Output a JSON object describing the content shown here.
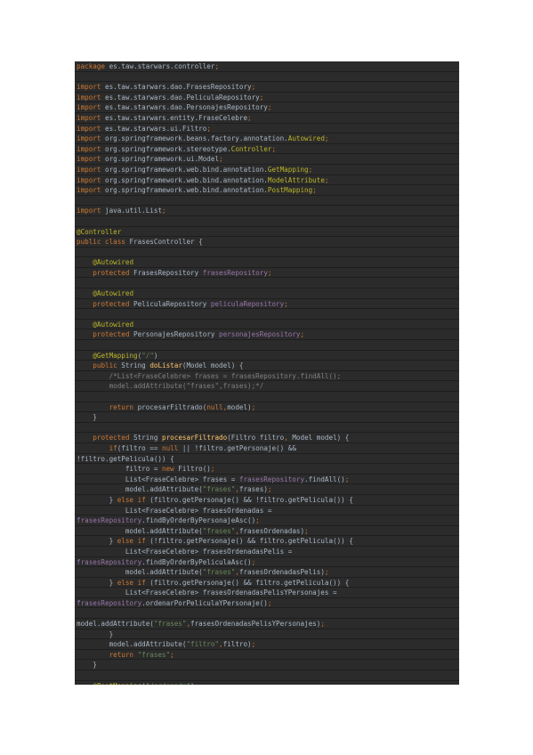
{
  "colors": {
    "background": "#2b2b2b",
    "text": "#a9b7c6",
    "keyword": "#cc7832",
    "annotation": "#bbb529",
    "field": "#9876aa",
    "method": "#ffc66d",
    "string": "#6a8759",
    "comment": "#808080"
  },
  "code_lines": [
    [
      [
        "kw",
        "package"
      ],
      [
        "txt",
        " es.taw.starwars.controller"
      ],
      [
        "kw",
        ";"
      ]
    ],
    [],
    [
      [
        "kw",
        "import"
      ],
      [
        "txt",
        " es.taw.starwars.dao.FrasesRepository"
      ],
      [
        "kw",
        ";"
      ]
    ],
    [
      [
        "kw",
        "import"
      ],
      [
        "txt",
        " es.taw.starwars.dao.PeliculaRepository"
      ],
      [
        "kw",
        ";"
      ]
    ],
    [
      [
        "kw",
        "import"
      ],
      [
        "txt",
        " es.taw.starwars.dao.PersonajesRepository"
      ],
      [
        "kw",
        ";"
      ]
    ],
    [
      [
        "kw",
        "import"
      ],
      [
        "txt",
        " es.taw.starwars.entity.FraseCelebre"
      ],
      [
        "kw",
        ";"
      ]
    ],
    [
      [
        "kw",
        "import"
      ],
      [
        "txt",
        " es.taw.starwars.ui.Filtro"
      ],
      [
        "kw",
        ";"
      ]
    ],
    [
      [
        "kw",
        "import"
      ],
      [
        "txt",
        " org.springframework.beans.factory.annotation."
      ],
      [
        "ann",
        "Autowired"
      ],
      [
        "kw",
        ";"
      ]
    ],
    [
      [
        "kw",
        "import"
      ],
      [
        "txt",
        " org.springframework.stereotype."
      ],
      [
        "ann",
        "Controller"
      ],
      [
        "kw",
        ";"
      ]
    ],
    [
      [
        "kw",
        "import"
      ],
      [
        "txt",
        " org.springframework.ui.Model"
      ],
      [
        "kw",
        ";"
      ]
    ],
    [
      [
        "kw",
        "import"
      ],
      [
        "txt",
        " org.springframework.web.bind.annotation."
      ],
      [
        "ann",
        "GetMapping"
      ],
      [
        "kw",
        ";"
      ]
    ],
    [
      [
        "kw",
        "import"
      ],
      [
        "txt",
        " org.springframework.web.bind.annotation."
      ],
      [
        "ann",
        "ModelAttribute"
      ],
      [
        "kw",
        ";"
      ]
    ],
    [
      [
        "kw",
        "import"
      ],
      [
        "txt",
        " org.springframework.web.bind.annotation."
      ],
      [
        "ann",
        "PostMapping"
      ],
      [
        "kw",
        ";"
      ]
    ],
    [],
    [
      [
        "kw",
        "import"
      ],
      [
        "txt",
        " java.util.List"
      ],
      [
        "kw",
        ";"
      ]
    ],
    [],
    [
      [
        "ann",
        "@Controller"
      ]
    ],
    [
      [
        "kw",
        "public class"
      ],
      [
        "txt",
        " FrasesController {"
      ]
    ],
    [],
    [
      [
        "txt",
        "    "
      ],
      [
        "ann",
        "@Autowired"
      ]
    ],
    [
      [
        "txt",
        "    "
      ],
      [
        "kw",
        "protected"
      ],
      [
        "txt",
        " FrasesRepository "
      ],
      [
        "field",
        "frasesRepository"
      ],
      [
        "kw",
        ";"
      ]
    ],
    [],
    [
      [
        "txt",
        "    "
      ],
      [
        "ann",
        "@Autowired"
      ]
    ],
    [
      [
        "txt",
        "    "
      ],
      [
        "kw",
        "protected"
      ],
      [
        "txt",
        " PeliculaRepository "
      ],
      [
        "field",
        "peliculaRepository"
      ],
      [
        "kw",
        ";"
      ]
    ],
    [],
    [
      [
        "txt",
        "    "
      ],
      [
        "ann",
        "@Autowired"
      ]
    ],
    [
      [
        "txt",
        "    "
      ],
      [
        "kw",
        "protected"
      ],
      [
        "txt",
        " PersonajesRepository "
      ],
      [
        "field",
        "personajesRepository"
      ],
      [
        "kw",
        ";"
      ]
    ],
    [],
    [
      [
        "txt",
        "    "
      ],
      [
        "ann",
        "@GetMapping"
      ],
      [
        "txt",
        "("
      ],
      [
        "str",
        "\"/\""
      ],
      [
        "txt",
        ")"
      ]
    ],
    [
      [
        "txt",
        "    "
      ],
      [
        "kw",
        "public"
      ],
      [
        "txt",
        " String "
      ],
      [
        "fn",
        "doListar"
      ],
      [
        "txt",
        "(Model model) {"
      ]
    ],
    [
      [
        "txt",
        "        "
      ],
      [
        "cmt",
        "/*List<FraseCelebre> frases = frasesRepository.findAll();"
      ]
    ],
    [
      [
        "txt",
        "        "
      ],
      [
        "cmt",
        "model.addAttribute(\"frases\",frases);*/"
      ]
    ],
    [],
    [
      [
        "txt",
        "        "
      ],
      [
        "kw",
        "return"
      ],
      [
        "txt",
        " procesarFiltrado("
      ],
      [
        "kw",
        "null"
      ],
      [
        "kw",
        ","
      ],
      [
        "txt",
        "model)"
      ],
      [
        "kw",
        ";"
      ]
    ],
    [
      [
        "txt",
        "    }"
      ]
    ],
    [],
    [
      [
        "txt",
        "    "
      ],
      [
        "kw",
        "protected"
      ],
      [
        "txt",
        " String "
      ],
      [
        "fn",
        "procesarFiltrado"
      ],
      [
        "txt",
        "(Filtro filtro"
      ],
      [
        "kw",
        ","
      ],
      [
        "txt",
        " Model model) {"
      ]
    ],
    [
      [
        "txt",
        "        "
      ],
      [
        "kw",
        "if"
      ],
      [
        "txt",
        "(filtro == "
      ],
      [
        "kw",
        "null"
      ],
      [
        "txt",
        " || !filtro.getPersonaje() &&"
      ]
    ],
    [
      [
        "txt",
        "!filtro.getPelicula()) {"
      ]
    ],
    [
      [
        "txt",
        "            filtro = "
      ],
      [
        "kw",
        "new"
      ],
      [
        "txt",
        " Filtro()"
      ],
      [
        "kw",
        ";"
      ]
    ],
    [
      [
        "txt",
        "            List<FraseCelebre> frases = "
      ],
      [
        "field",
        "frasesRepository"
      ],
      [
        "txt",
        ".findAll()"
      ],
      [
        "kw",
        ";"
      ]
    ],
    [
      [
        "txt",
        "            model.addAttribute("
      ],
      [
        "str",
        "\"frases\""
      ],
      [
        "kw",
        ","
      ],
      [
        "txt",
        "frases)"
      ],
      [
        "kw",
        ";"
      ]
    ],
    [
      [
        "txt",
        "        } "
      ],
      [
        "kw",
        "else if"
      ],
      [
        "txt",
        " (filtro.getPersonaje() && !filtro.getPelicula()) {"
      ]
    ],
    [
      [
        "txt",
        "            List<FraseCelebre> frasesOrdenadas ="
      ]
    ],
    [
      [
        "field",
        "frasesRepository"
      ],
      [
        "txt",
        ".findByOrderByPersonajeAsc()"
      ],
      [
        "kw",
        ";"
      ]
    ],
    [
      [
        "txt",
        "            model.addAttribute("
      ],
      [
        "str",
        "\"frases\""
      ],
      [
        "kw",
        ","
      ],
      [
        "txt",
        "frasesOrdenadas)"
      ],
      [
        "kw",
        ";"
      ]
    ],
    [
      [
        "txt",
        "        } "
      ],
      [
        "kw",
        "else if"
      ],
      [
        "txt",
        " (!filtro.getPersonaje() && filtro.getPelicula()) {"
      ]
    ],
    [
      [
        "txt",
        "            List<FraseCelebre> frasesOrdenadasPelis ="
      ]
    ],
    [
      [
        "field",
        "frasesRepository"
      ],
      [
        "txt",
        ".findByOrderByPeliculaAsc()"
      ],
      [
        "kw",
        ";"
      ]
    ],
    [
      [
        "txt",
        "            model.addAttribute("
      ],
      [
        "str",
        "\"frases\""
      ],
      [
        "kw",
        ","
      ],
      [
        "txt",
        "frasesOrdenadasPelis)"
      ],
      [
        "kw",
        ";"
      ]
    ],
    [
      [
        "txt",
        "        } "
      ],
      [
        "kw",
        "else if"
      ],
      [
        "txt",
        " (filtro.getPersonaje() && filtro.getPelicula()) {"
      ]
    ],
    [
      [
        "txt",
        "            List<FraseCelebre> frasesOrdenadasPelisYPersonajes ="
      ]
    ],
    [
      [
        "field",
        "frasesRepository"
      ],
      [
        "txt",
        ".ordenarPorPeliculaYPersonaje()"
      ],
      [
        "kw",
        ";"
      ]
    ],
    [],
    [
      [
        "txt",
        "model.addAttribute("
      ],
      [
        "str",
        "\"frases\""
      ],
      [
        "kw",
        ","
      ],
      [
        "txt",
        "frasesOrdenadasPelisYPersonajes)"
      ],
      [
        "kw",
        ";"
      ]
    ],
    [
      [
        "txt",
        "        }"
      ]
    ],
    [
      [
        "txt",
        "        model.addAttribute("
      ],
      [
        "str",
        "\"filtro\""
      ],
      [
        "kw",
        ","
      ],
      [
        "txt",
        "filtro)"
      ],
      [
        "kw",
        ";"
      ]
    ],
    [
      [
        "txt",
        "        "
      ],
      [
        "kw",
        "return"
      ],
      [
        "txt",
        " "
      ],
      [
        "str",
        "\"frases\""
      ],
      [
        "kw",
        ";"
      ]
    ],
    [
      [
        "txt",
        "    }"
      ]
    ],
    [],
    [
      [
        "txt",
        "    "
      ],
      [
        "ann",
        "@PostMapping"
      ],
      [
        "txt",
        "("
      ],
      [
        "str",
        "\"/ordenado\""
      ],
      [
        "txt",
        ")"
      ]
    ]
  ]
}
